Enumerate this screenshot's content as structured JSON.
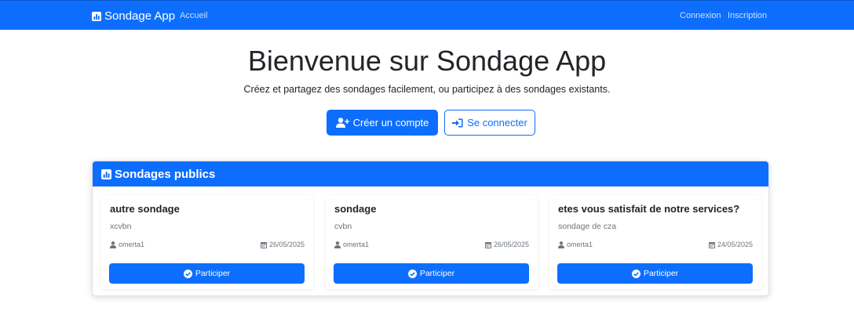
{
  "navbar": {
    "brand": "Sondage App",
    "home_link": "Accueil",
    "login_link": "Connexion",
    "register_link": "Inscription",
    "color": "#0d6efd"
  },
  "hero": {
    "title": "Bienvenue sur Sondage App",
    "subtitle": "Créez et partagez des sondages facilement, ou participez à des sondages existants.",
    "create_account_label": "Créer un compte",
    "login_label": "Se connecter"
  },
  "public_polls": {
    "header": "Sondages publics",
    "participate_label": "Participer",
    "items": [
      {
        "title": "autre sondage",
        "description": "xcvbn",
        "author": "omerta1",
        "date": "26/05/2025"
      },
      {
        "title": "sondage",
        "description": "cvbn",
        "author": "omerta1",
        "date": "26/05/2025"
      },
      {
        "title": "etes vous satisfait de notre services?",
        "description": "sondage de cza",
        "author": "omerta1",
        "date": "24/05/2025"
      }
    ]
  },
  "icons": {
    "brand": "bar-chart-icon",
    "create_account": "user-plus-icon",
    "login": "sign-in-icon",
    "author": "user-icon",
    "date": "calendar-icon",
    "participate": "check-circle-icon"
  }
}
